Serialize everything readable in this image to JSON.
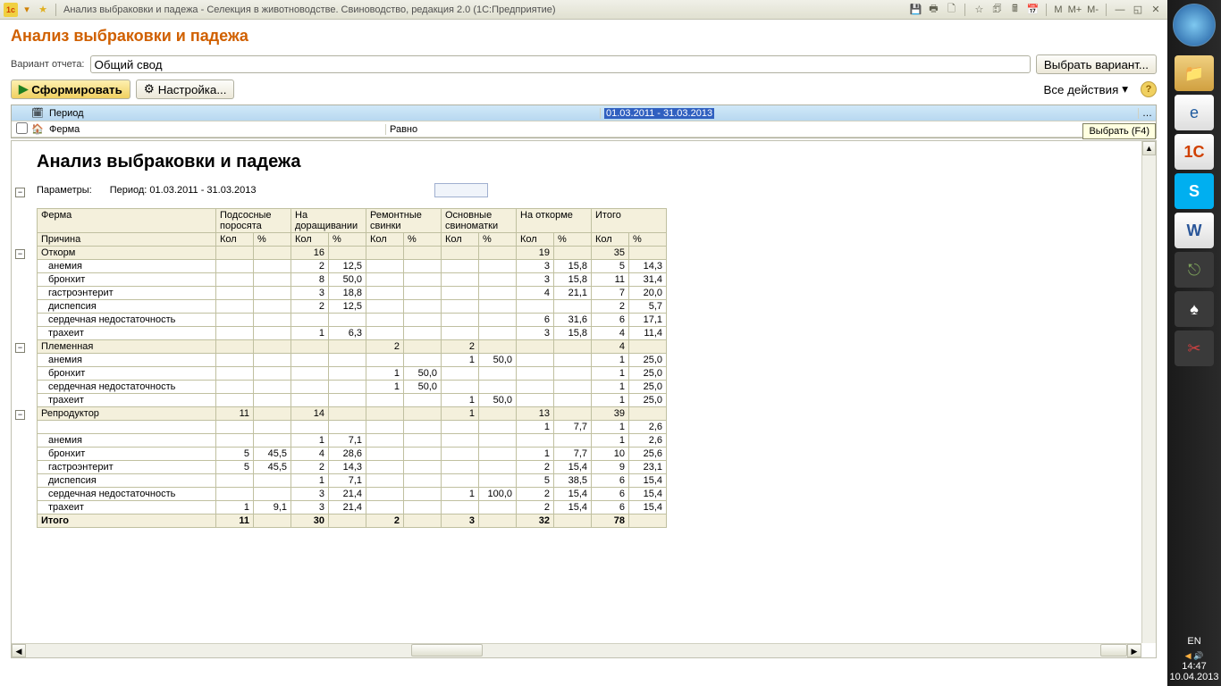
{
  "window": {
    "title": "Анализ выбраковки и падежа - Селекция в животноводстве. Свиноводство, редакция 2.0  (1С:Предприятие)",
    "mem_buttons": [
      "M",
      "M+",
      "M-"
    ]
  },
  "page": {
    "title": "Анализ выбраковки и падежа",
    "variant_label": "Вариант отчета:",
    "variant_value": "Общий свод",
    "choose_variant": "Выбрать вариант...",
    "form_btn": "Сформировать",
    "settings_btn": "Настройка...",
    "all_actions": "Все действия"
  },
  "filters": {
    "period_label": "Период",
    "period_value": "01.03.2011 - 31.03.2013",
    "farm_label": "Ферма",
    "op_equal": "Равно",
    "tooltip": "Выбрать (F4)"
  },
  "report": {
    "title": "Анализ выбраковки и падежа",
    "params_label": "Параметры:",
    "params_period": "Период: 01.03.2011 - 31.03.2013",
    "headers": {
      "farm": "Ферма",
      "cause": "Причина",
      "suckling": "Подсосные поросята",
      "nursing": "На доращивании",
      "gilts": "Ремонтные свинки",
      "sows": "Основные свиноматки",
      "fattening": "На откорме",
      "total": "Итого",
      "qty": "Кол",
      "pct": "%"
    },
    "groups": [
      {
        "name": "Откорм",
        "totals": {
          "nursing_k": "16",
          "fattening_k": "19",
          "total_k": "35"
        },
        "rows": [
          {
            "cause": "анемия",
            "nursing_k": "2",
            "nursing_p": "12,5",
            "fattening_k": "3",
            "fattening_p": "15,8",
            "total_k": "5",
            "total_p": "14,3"
          },
          {
            "cause": "бронхит",
            "nursing_k": "8",
            "nursing_p": "50,0",
            "fattening_k": "3",
            "fattening_p": "15,8",
            "total_k": "11",
            "total_p": "31,4"
          },
          {
            "cause": "гастроэнтерит",
            "nursing_k": "3",
            "nursing_p": "18,8",
            "fattening_k": "4",
            "fattening_p": "21,1",
            "total_k": "7",
            "total_p": "20,0"
          },
          {
            "cause": "диспепсия",
            "nursing_k": "2",
            "nursing_p": "12,5",
            "total_k": "2",
            "total_p": "5,7"
          },
          {
            "cause": "сердечная недостаточность",
            "fattening_k": "6",
            "fattening_p": "31,6",
            "total_k": "6",
            "total_p": "17,1"
          },
          {
            "cause": "трахеит",
            "nursing_k": "1",
            "nursing_p": "6,3",
            "fattening_k": "3",
            "fattening_p": "15,8",
            "total_k": "4",
            "total_p": "11,4"
          }
        ]
      },
      {
        "name": "Племенная",
        "totals": {
          "gilts_k": "2",
          "sows_k": "2",
          "total_k": "4"
        },
        "rows": [
          {
            "cause": "анемия",
            "sows_k": "1",
            "sows_p": "50,0",
            "total_k": "1",
            "total_p": "25,0"
          },
          {
            "cause": "бронхит",
            "gilts_k": "1",
            "gilts_p": "50,0",
            "total_k": "1",
            "total_p": "25,0"
          },
          {
            "cause": "сердечная недостаточность",
            "gilts_k": "1",
            "gilts_p": "50,0",
            "total_k": "1",
            "total_p": "25,0"
          },
          {
            "cause": "трахеит",
            "sows_k": "1",
            "sows_p": "50,0",
            "total_k": "1",
            "total_p": "25,0"
          }
        ]
      },
      {
        "name": "Репродуктор",
        "totals": {
          "suckling_k": "11",
          "nursing_k": "14",
          "sows_k": "1",
          "fattening_k": "13",
          "total_k": "39"
        },
        "rows": [
          {
            "cause": "",
            "fattening_k": "1",
            "fattening_p": "7,7",
            "total_k": "1",
            "total_p": "2,6"
          },
          {
            "cause": "анемия",
            "nursing_k": "1",
            "nursing_p": "7,1",
            "total_k": "1",
            "total_p": "2,6"
          },
          {
            "cause": "бронхит",
            "suckling_k": "5",
            "suckling_p": "45,5",
            "nursing_k": "4",
            "nursing_p": "28,6",
            "fattening_k": "1",
            "fattening_p": "7,7",
            "total_k": "10",
            "total_p": "25,6"
          },
          {
            "cause": "гастроэнтерит",
            "suckling_k": "5",
            "suckling_p": "45,5",
            "nursing_k": "2",
            "nursing_p": "14,3",
            "fattening_k": "2",
            "fattening_p": "15,4",
            "total_k": "9",
            "total_p": "23,1"
          },
          {
            "cause": "диспепсия",
            "nursing_k": "1",
            "nursing_p": "7,1",
            "fattening_k": "5",
            "fattening_p": "38,5",
            "total_k": "6",
            "total_p": "15,4"
          },
          {
            "cause": "сердечная недостаточность",
            "nursing_k": "3",
            "nursing_p": "21,4",
            "sows_k": "1",
            "sows_p": "100,0",
            "fattening_k": "2",
            "fattening_p": "15,4",
            "total_k": "6",
            "total_p": "15,4"
          },
          {
            "cause": "трахеит",
            "suckling_k": "1",
            "suckling_p": "9,1",
            "nursing_k": "3",
            "nursing_p": "21,4",
            "fattening_k": "2",
            "fattening_p": "15,4",
            "total_k": "6",
            "total_p": "15,4"
          }
        ]
      }
    ],
    "grand_total": {
      "label": "Итого",
      "suckling_k": "11",
      "nursing_k": "30",
      "gilts_k": "2",
      "sows_k": "3",
      "fattening_k": "32",
      "total_k": "78"
    }
  },
  "system": {
    "lang": "EN",
    "time": "14:47",
    "date": "10.04.2013"
  }
}
